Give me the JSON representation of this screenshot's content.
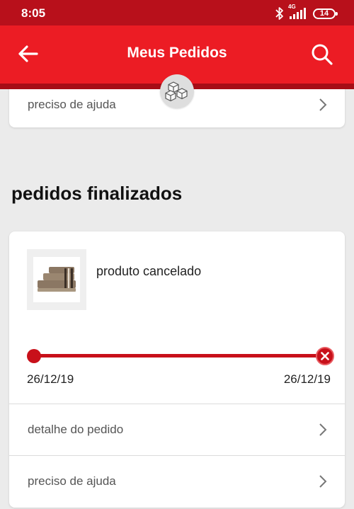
{
  "status_bar": {
    "time": "8:05",
    "network": "4G",
    "battery": "14"
  },
  "app_bar": {
    "title": "Meus Pedidos",
    "back_icon": "arrow-left-icon",
    "search_icon": "search-icon",
    "badge_icon": "boxes-icon"
  },
  "top_card": {
    "help_label": "preciso de ajuda"
  },
  "section": {
    "title": "pedidos finalizados"
  },
  "order": {
    "status": "produto cancelado",
    "progress": {
      "start_date": "26/12/19",
      "end_date": "26/12/19",
      "state": "cancelled"
    },
    "detail_label": "detalhe do pedido",
    "help_label": "preciso de ajuda"
  },
  "colors": {
    "primary": "#ec1c24",
    "status_bar": "#b8101b",
    "progress": "#c8101a",
    "background": "#ebebeb"
  }
}
